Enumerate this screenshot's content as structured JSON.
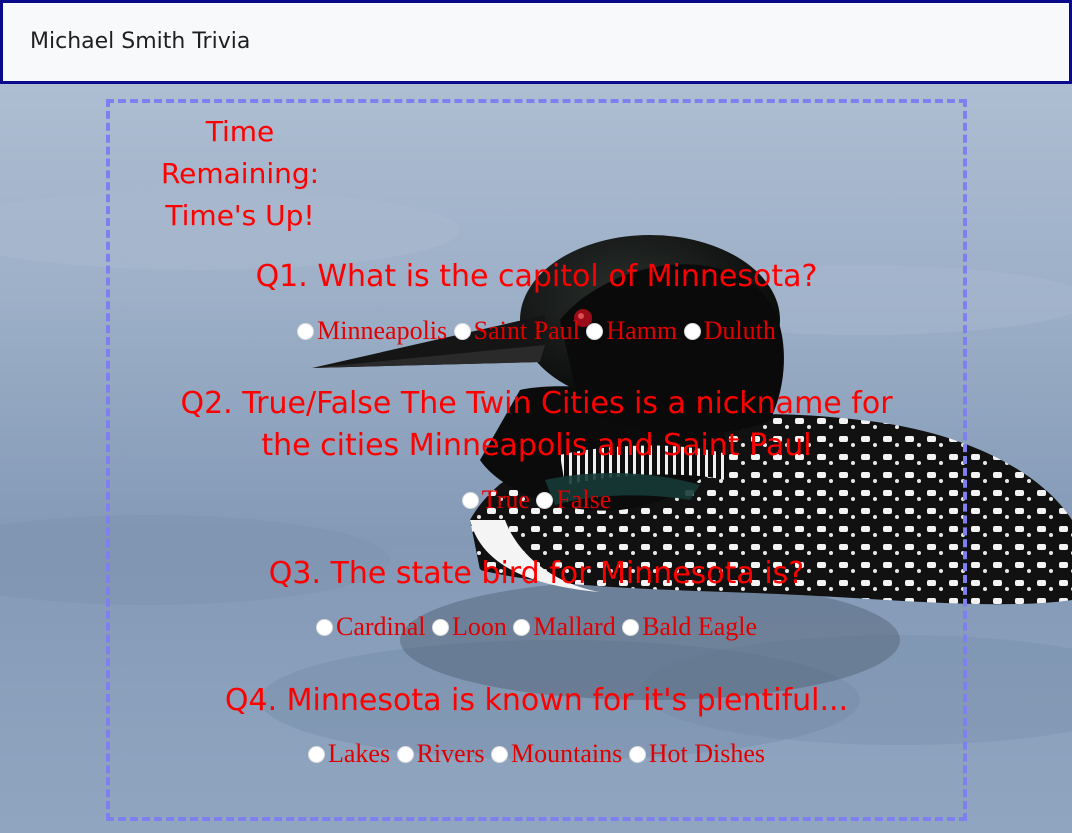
{
  "navbar": {
    "brand": "Michael Smith Trivia"
  },
  "timer": {
    "label_line1": "Time",
    "label_line2": "Remaining:",
    "value": "Time's Up!"
  },
  "questions": [
    {
      "text": "Q1. What is the capitol of Minnesota?",
      "options": [
        "Minneapolis",
        "Saint Paul",
        "Hamm",
        "Duluth"
      ]
    },
    {
      "text_line1": "Q2. True/False The Twin Cities is a nickname for",
      "text_line2": "the cities Minneapolis and Saint Paul",
      "options": [
        "True",
        "False"
      ]
    },
    {
      "text": "Q3. The state bird for Minnesota is?",
      "options": [
        "Cardinal",
        "Loon",
        "Mallard",
        "Bald Eagle"
      ]
    },
    {
      "text": "Q4. Minnesota is known for it's plentiful...",
      "options": [
        "Lakes",
        "Rivers",
        "Mountains",
        "Hot Dishes"
      ]
    }
  ],
  "colors": {
    "text_red": "#ff0000",
    "border_dashed": "#7f7ff0",
    "navbar_border": "#0a0a8a",
    "navbar_bg": "#f8f9fb"
  },
  "icons": {
    "background": "loon-photo",
    "answer_choice": "radio-button-icon"
  }
}
